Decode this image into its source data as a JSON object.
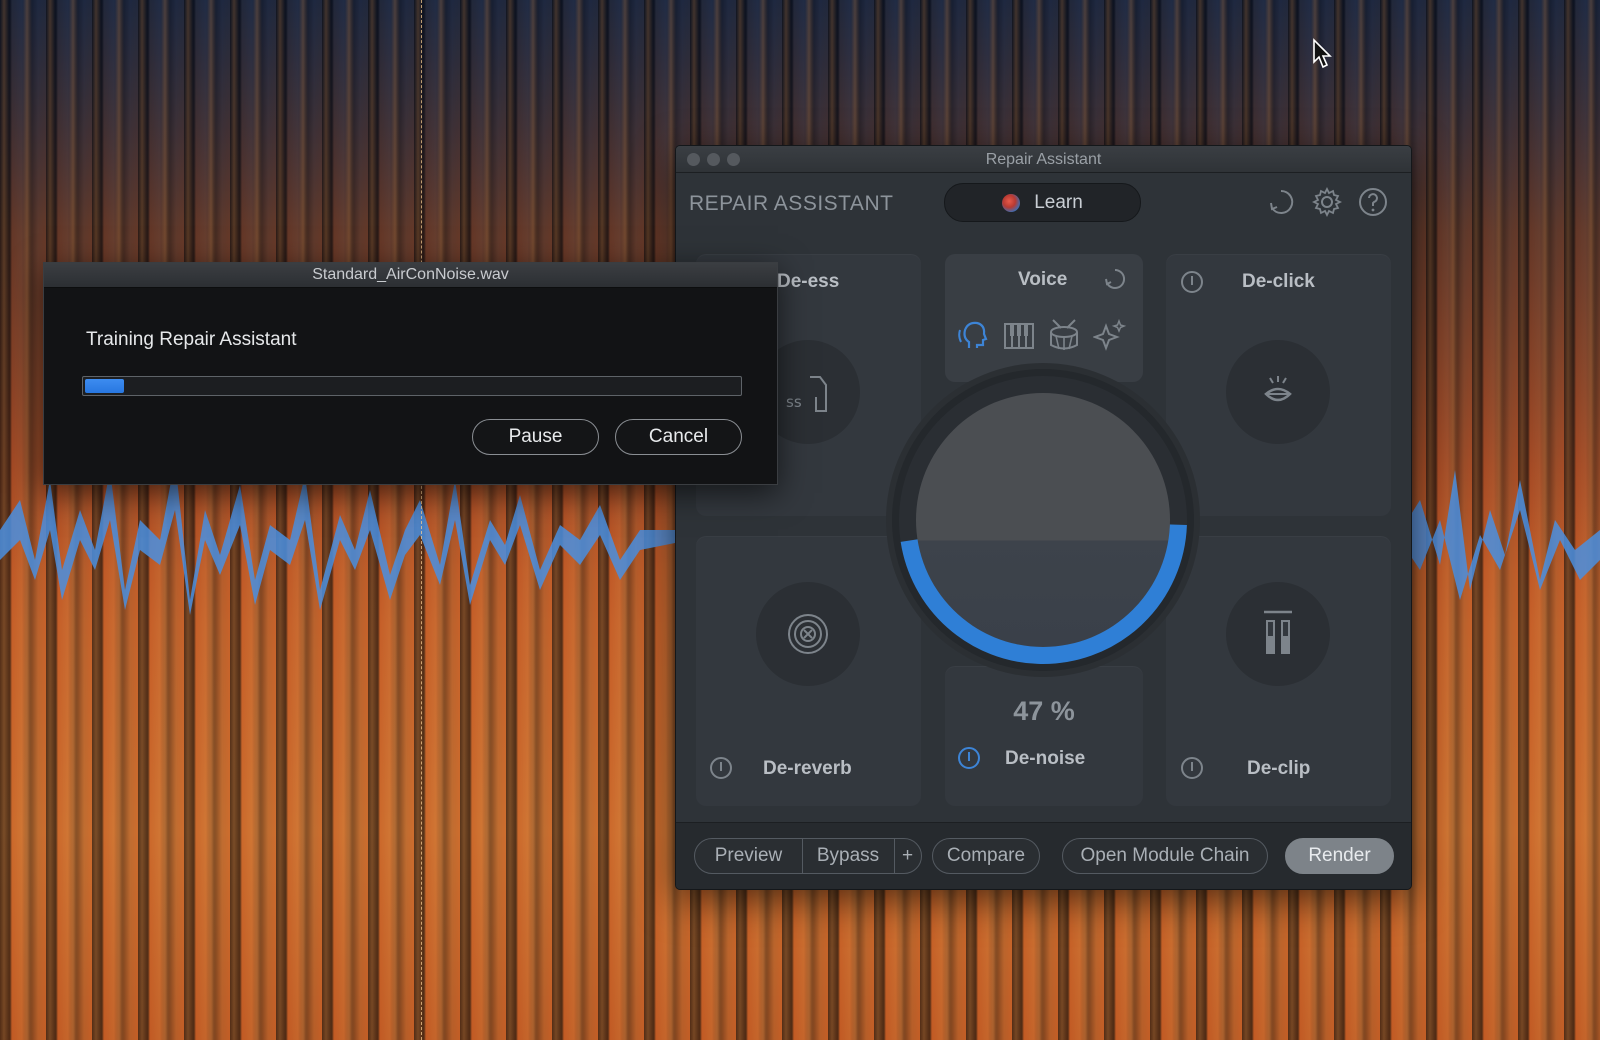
{
  "colors": {
    "accent": "#2f80e8",
    "panel": "#2e3338",
    "dialog_bg": "#121315",
    "spectrogram_orange": "#d07634",
    "waveform_blue": "#4a8fe0"
  },
  "repair_window": {
    "title": "Repair Assistant",
    "brand": "REPAIR ASSISTANT",
    "learn_label": "Learn",
    "header_icons": [
      "undo-icon",
      "gear-icon",
      "help-icon"
    ]
  },
  "modules": {
    "de_ess": {
      "label": "De-ess",
      "icon": "sibilance-icon"
    },
    "voice": {
      "label": "Voice",
      "icons": [
        "voice-icon",
        "piano-icon",
        "drum-icon",
        "sparkle-icon"
      ]
    },
    "de_click": {
      "label": "De-click",
      "icon": "mouth-click-icon"
    },
    "de_reverb": {
      "label": "De-reverb",
      "icon": "reverb-target-icon"
    },
    "de_noise": {
      "label": "De-noise",
      "amount": "47 %",
      "amount_fraction": 0.47
    },
    "de_clip": {
      "label": "De-clip",
      "icon": "clip-bars-icon"
    }
  },
  "bottom_bar": {
    "preview": "Preview",
    "bypass": "Bypass",
    "add": "+",
    "compare": "Compare",
    "open_module_chain": "Open Module Chain",
    "render": "Render"
  },
  "dialog": {
    "title": "Standard_AirConNoise.wav",
    "message": "Training Repair Assistant",
    "progress_fraction": 0.06,
    "pause": "Pause",
    "cancel": "Cancel"
  }
}
